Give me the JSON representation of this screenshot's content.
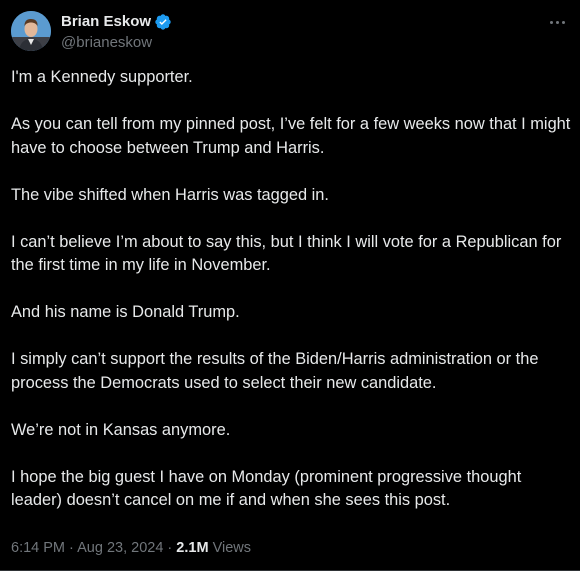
{
  "author": {
    "display_name": "Brian Eskow",
    "handle": "@brianeskow",
    "verified": true
  },
  "tweet": {
    "paragraphs": [
      "I'm a Kennedy supporter.",
      "As you can tell from my pinned post, I’ve felt for a few weeks now that I might have to choose between Trump and Harris.",
      "The vibe shifted when Harris was tagged in.",
      "I can’t believe I’m about to say this, but I think I will vote for a Republican for the first time in my life in November.",
      "And his name is Donald Trump.",
      "I simply can’t support the results of the Biden/Harris administration or the process the Democrats used to select their new candidate.",
      "We’re not in Kansas anymore.",
      "I hope the big guest I have on Monday (prominent progressive thought leader) doesn’t cancel on me if and when she sees this post."
    ],
    "time": "6:14 PM",
    "date": "Aug 23, 2024",
    "separator": "·",
    "views_count": "2.1M",
    "views_label": "Views"
  },
  "colors": {
    "background": "#000000",
    "text_primary": "#e7e9ea",
    "text_secondary": "#71767b",
    "verified_badge": "#1d9bf0"
  },
  "icons": {
    "verified": "verified-badge-icon",
    "more": "more-options-icon"
  }
}
